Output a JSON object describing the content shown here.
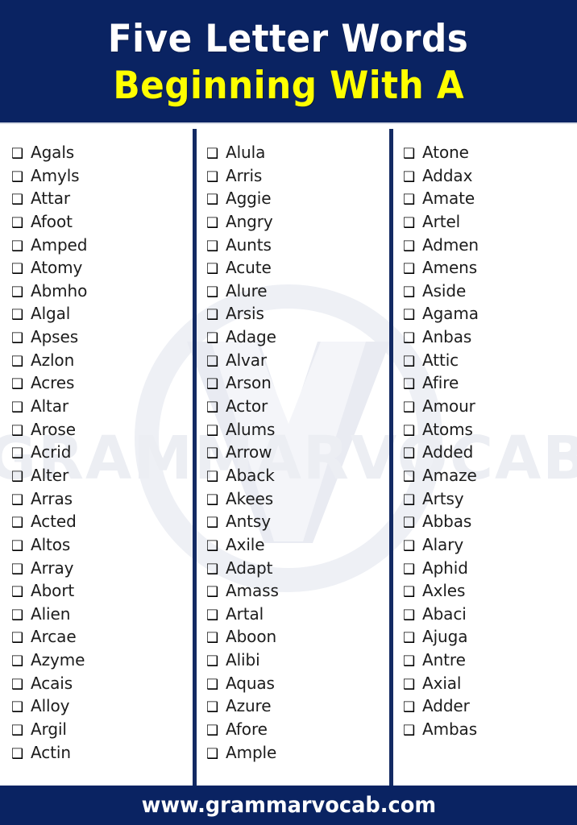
{
  "header": {
    "title_main": "Five Letter Words",
    "title_sub": "Beginning With A",
    "background_color": "#0a2362",
    "title_main_color": "#ffffff",
    "title_sub_color": "#ffff00"
  },
  "watermark": {
    "text": "GRAMMARVOCAB",
    "color": "#eceef3"
  },
  "list": {
    "checkbox_glyph": "❑",
    "columns": [
      {
        "id": "column-1",
        "words": [
          "Agals",
          "Amyls",
          "Attar",
          "Afoot",
          "Amped",
          "Atomy",
          "Abmho",
          "Algal",
          "Apses",
          "Azlon",
          "Acres",
          "Altar",
          "Arose",
          "Acrid",
          "Alter",
          "Arras",
          "Acted",
          "Altos",
          "Array",
          "Abort",
          "Alien",
          "Arcae",
          "Azyme",
          "Acais",
          "Alloy",
          "Argil",
          "Actin"
        ]
      },
      {
        "id": "column-2",
        "words": [
          "Alula",
          "Arris",
          "Aggie",
          "Angry",
          "Aunts",
          "Acute",
          "Alure",
          "Arsis",
          "Adage",
          "Alvar",
          "Arson",
          "Actor",
          "Alums",
          "Arrow",
          "Aback",
          "Akees",
          "Antsy",
          "Axile",
          "Adapt",
          "Amass",
          "Artal",
          "Aboon",
          "Alibi",
          "Aquas",
          "Azure",
          "Afore",
          "Ample"
        ]
      },
      {
        "id": "column-3",
        "words": [
          "Atone",
          "Addax",
          "Amate",
          "Artel",
          "Admen",
          "Amens",
          "Aside",
          "Agama",
          "Anbas",
          "Attic",
          "Afire",
          "Amour",
          "Atoms",
          "Added",
          "Amaze",
          "Artsy",
          "Abbas",
          "Alary",
          "Aphid",
          "Axles",
          "Abaci",
          "Ajuga",
          "Antre",
          "Axial",
          "Adder",
          "Ambas"
        ]
      }
    ]
  },
  "footer": {
    "website": "www.grammarvocab.com",
    "background_color": "#0a2362",
    "text_color": "#ffffff"
  }
}
